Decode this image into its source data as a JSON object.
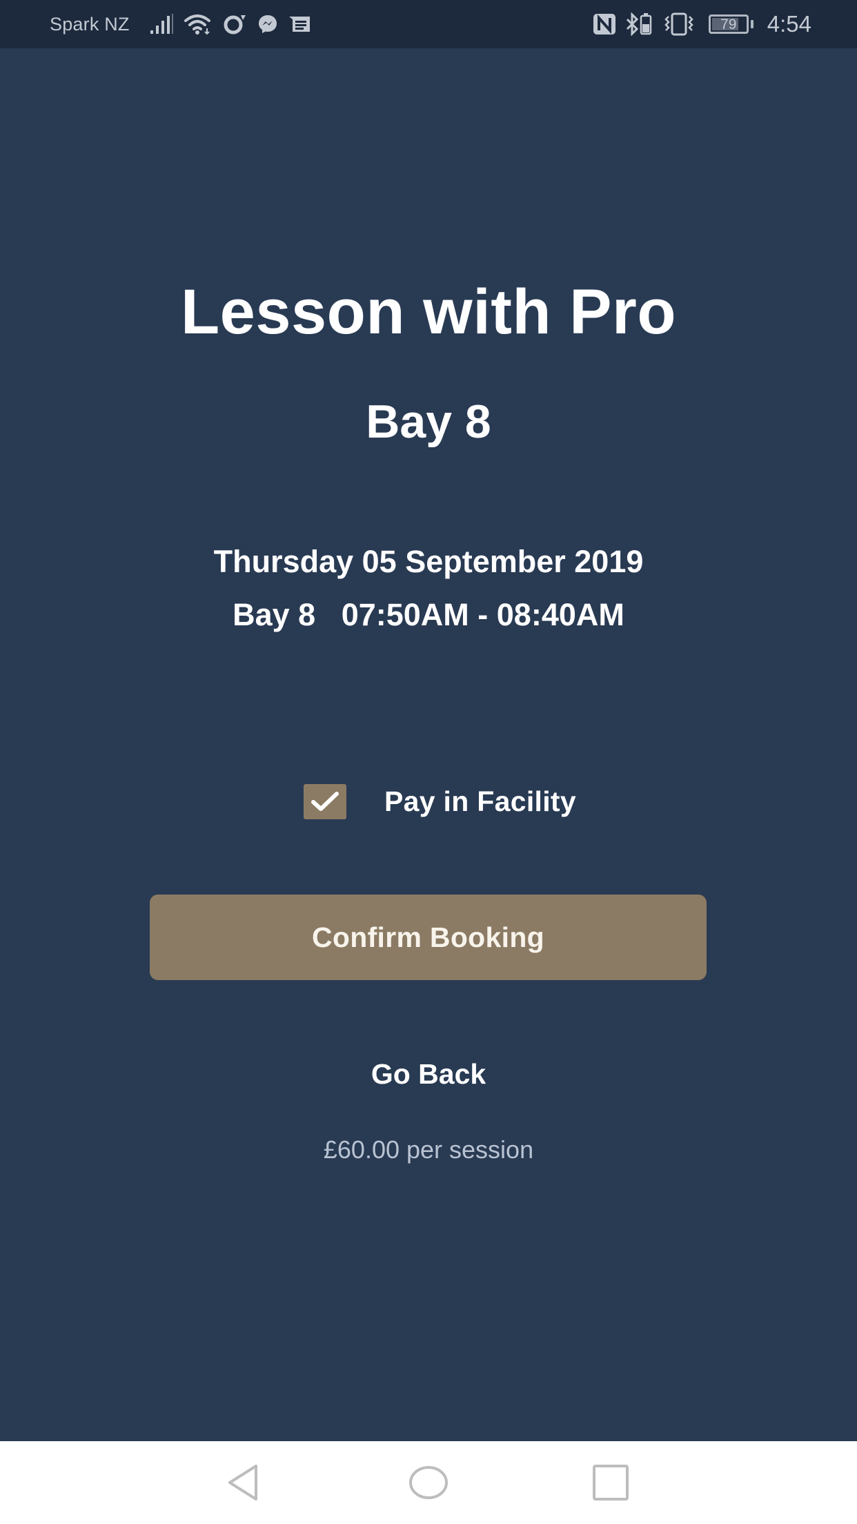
{
  "status_bar": {
    "carrier": "Spark NZ",
    "left_icons": [
      "signal-icon",
      "wifi-icon",
      "circle-app-icon",
      "messenger-icon",
      "message-icon"
    ],
    "right_icons": [
      "nfc-icon",
      "bluetooth-icon",
      "vibrate-icon"
    ],
    "battery_level": "79",
    "battery_fraction": 0.79,
    "time": "4:54"
  },
  "booking": {
    "title": "Lesson with Pro",
    "subtitle": "Bay 8",
    "date": "Thursday 05 September 2019",
    "slot": "Bay 8   07:50AM - 08:40AM"
  },
  "payment": {
    "option_label": "Pay in Facility",
    "checked": true
  },
  "actions": {
    "confirm_label": "Confirm Booking",
    "go_back_label": "Go Back"
  },
  "price_text": "£60.00 per session",
  "colors": {
    "background": "#293a53",
    "status_bar": "#1d2a3d",
    "accent": "#8c7b64",
    "price_text": "#b9c3d2"
  },
  "nav_bar": {
    "buttons": [
      "back",
      "home",
      "recents"
    ]
  }
}
